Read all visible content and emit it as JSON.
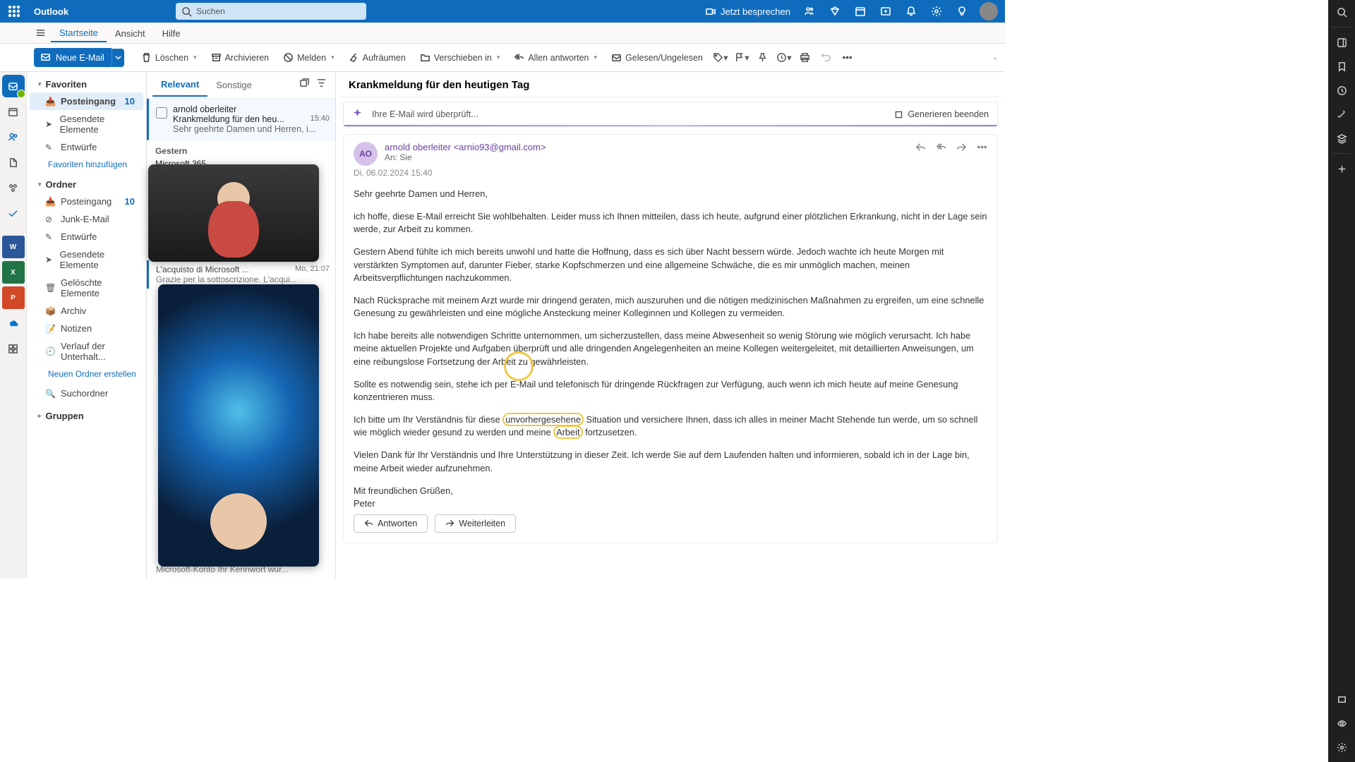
{
  "app": {
    "name": "Outlook"
  },
  "search": {
    "placeholder": "Suchen"
  },
  "header": {
    "meet_now": "Jetzt besprechen"
  },
  "tabs": {
    "home": "Startseite",
    "view": "Ansicht",
    "help": "Hilfe"
  },
  "toolbar": {
    "new_mail": "Neue E-Mail",
    "delete": "Löschen",
    "archive": "Archivieren",
    "report": "Melden",
    "sweep": "Aufräumen",
    "move_to": "Verschieben in",
    "reply_all": "Allen antworten",
    "read_unread": "Gelesen/Ungelesen"
  },
  "folders": {
    "favorites": "Favoriten",
    "inbox": "Posteingang",
    "inbox_count": "10",
    "sent": "Gesendete Elemente",
    "drafts": "Entwürfe",
    "add_fav": "Favoriten hinzufügen",
    "ordner": "Ordner",
    "junk": "Junk-E-Mail",
    "deleted": "Gelöschte Elemente",
    "archive": "Archiv",
    "notes": "Notizen",
    "history": "Verlauf der Unterhalt...",
    "new_folder": "Neuen Ordner erstellen",
    "search_folder": "Suchordner",
    "groups": "Gruppen"
  },
  "list": {
    "tab_focused": "Relevant",
    "tab_other": "Sonstige",
    "item1": {
      "from": "arnold oberleiter",
      "subject": "Krankmeldung für den heu...",
      "time": "15:40",
      "preview": "Sehr geehrte Damen und Herren, i..."
    },
    "day_sep": "Gestern",
    "item_ms365": "Microsoft 365",
    "item2": {
      "subject": "L'acquisto di Microsoft ...",
      "time": "Mo, 21:07",
      "preview": "Grazie per la sottoscrizione. L'acqui..."
    },
    "item3_preview": "Microsoft-Konto Ihr Kennwort wur..."
  },
  "read": {
    "subject": "Krankmeldung für den heutigen Tag",
    "checking": "Ihre E-Mail wird überprüft...",
    "stop_gen": "Generieren beenden",
    "from_name": "arnold oberleiter",
    "from_addr": "<arnio93@gmail.com>",
    "to_label": "An:",
    "to_value": "Sie",
    "date": "Di, 06.02.2024 15:40",
    "avatar": "AO",
    "p1": "Sehr geehrte Damen und Herren,",
    "p2": "ich hoffe, diese E-Mail erreicht Sie wohlbehalten. Leider muss ich Ihnen mitteilen, dass ich heute, aufgrund einer plötzlichen Erkrankung, nicht in der Lage sein werde, zur Arbeit zu kommen.",
    "p3": "Gestern Abend fühlte ich mich bereits unwohl und hatte die Hoffnung, dass es sich über Nacht bessern würde. Jedoch wachte ich heute Morgen mit verstärkten Symptomen auf, darunter Fieber, starke Kopfschmerzen und eine allgemeine Schwäche, die es mir unmöglich machen, meinen Arbeitsverpflichtungen nachzukommen.",
    "p4": "Nach Rücksprache mit meinem Arzt wurde mir dringend geraten, mich auszuruhen und die nötigen medizinischen Maßnahmen zu ergreifen, um eine schnelle Genesung zu gewährleisten und eine mögliche Ansteckung meiner Kolleginnen und Kollegen zu vermeiden.",
    "p5": "Ich habe bereits alle notwendigen Schritte unternommen, um sicherzustellen, dass meine Abwesenheit so wenig Störung wie möglich verursacht. Ich habe meine aktuellen Projekte und Aufgaben überprüft und alle dringenden Angelegenheiten an meine Kollegen weitergeleitet, mit detaillierten Anweisungen, um eine reibungslose Fortsetzung der Arbeit zu gewährleisten.",
    "p6": "Sollte es notwendig sein, stehe ich per E-Mail und telefonisch für dringende Rückfragen zur Verfügung, auch wenn ich mich heute auf meine Genesung konzentrieren muss.",
    "p7a": "Ich bitte um Ihr Verständnis für diese ",
    "p7_hl1": "unvorhergesehene",
    "p7b": " Situation und versichere Ihnen, dass ich alles in meiner Macht Stehende tun werde, um so schnell wie möglich wieder gesund zu werden und meine ",
    "p7_hl2": "Arbeit",
    "p7c": " fortzusetzen.",
    "p8": "Vielen Dank für Ihr Verständnis und Ihre Unterstützung in dieser Zeit. Ich werde Sie auf dem Laufenden halten und informieren, sobald ich in der Lage bin, meine Arbeit wieder aufzunehmen.",
    "p9": "Mit freundlichen Grüßen,",
    "p10": "Peter",
    "reply": "Antworten",
    "forward": "Weiterleiten"
  }
}
